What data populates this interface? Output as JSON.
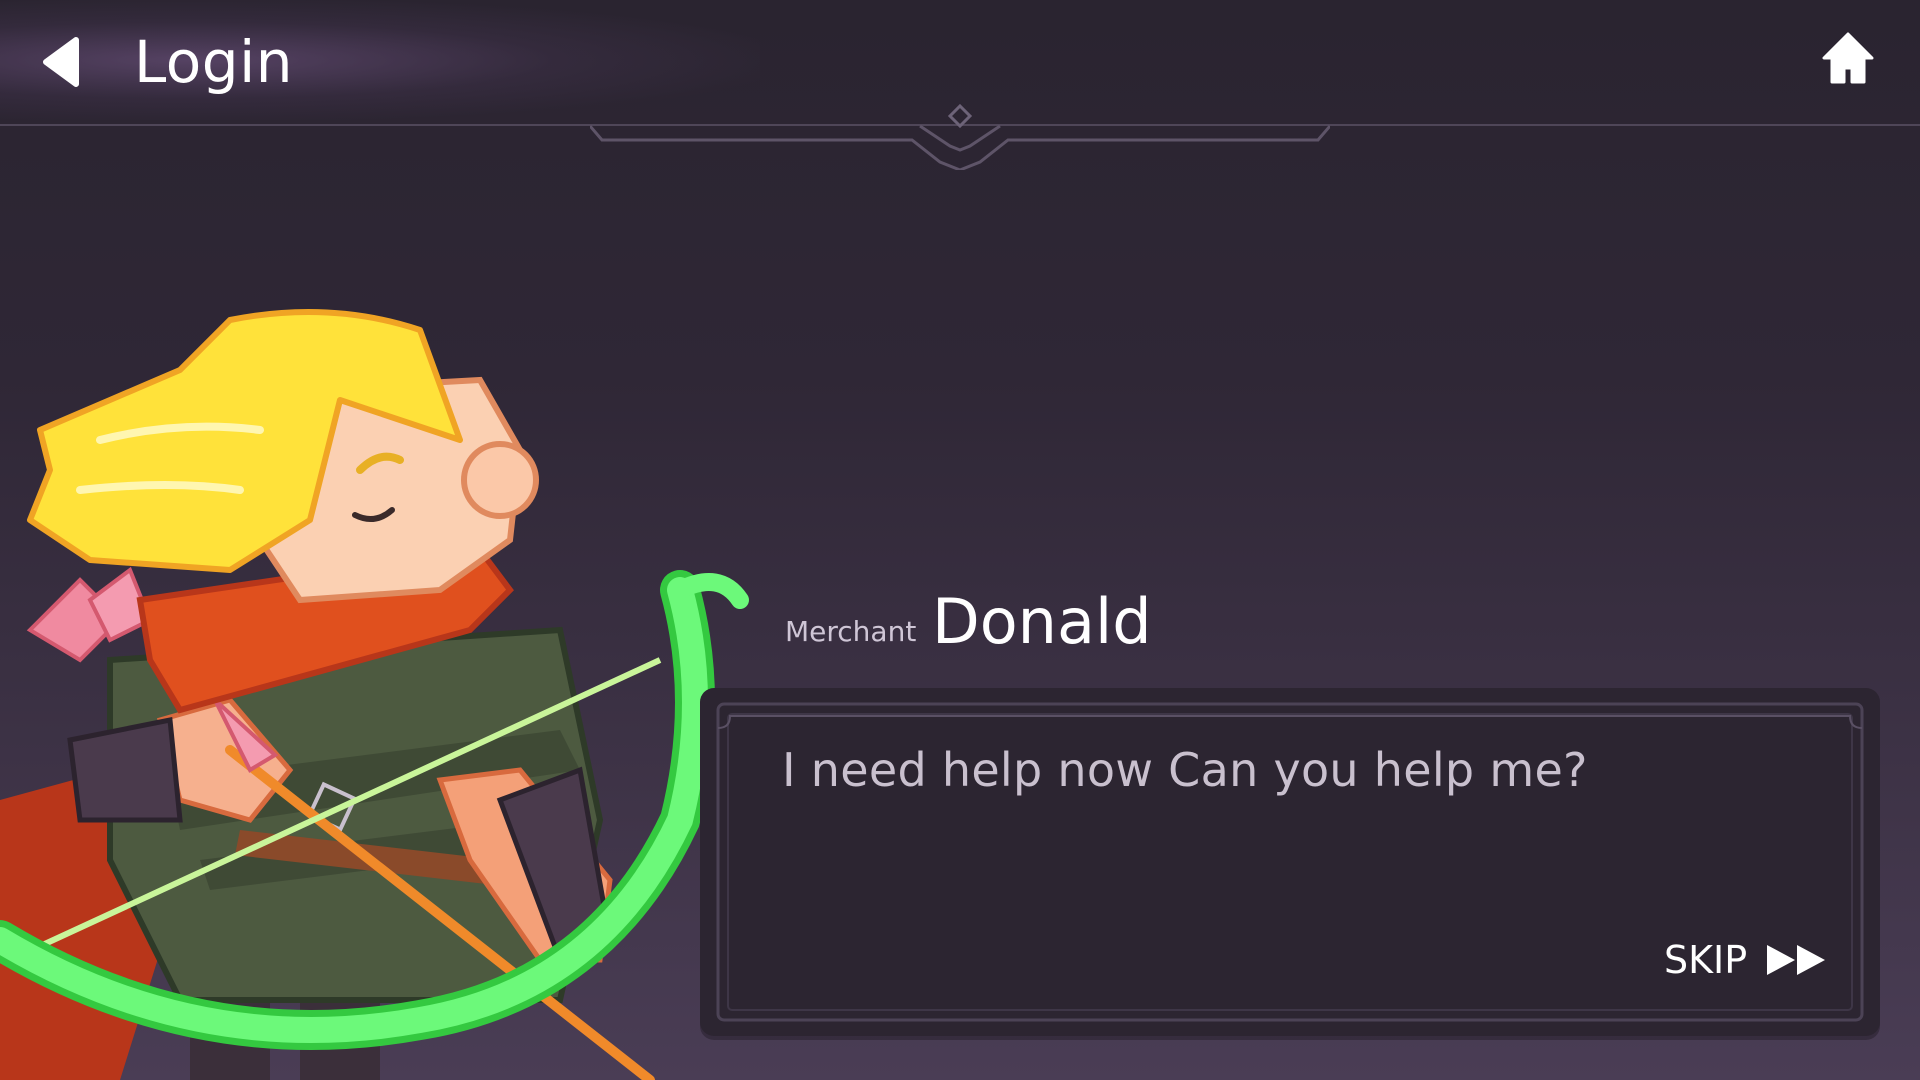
{
  "header": {
    "title": "Login",
    "back_icon": "back-arrow-icon",
    "home_icon": "home-icon"
  },
  "dialog": {
    "speaker_role": "Merchant",
    "speaker_name": "Donald",
    "message": "I need help now Can you help me?",
    "skip_label": "SKIP",
    "skip_icon": "fast-forward-icon"
  },
  "colors": {
    "background_top": "#2a2430",
    "background_bottom": "#4a3d55",
    "dialog_bg": "#2c2531",
    "dialog_text": "#c9c0ce",
    "bow_green": "#5cf56a",
    "hair_yellow": "#ffe23a",
    "scarf_orange": "#e0501e"
  }
}
